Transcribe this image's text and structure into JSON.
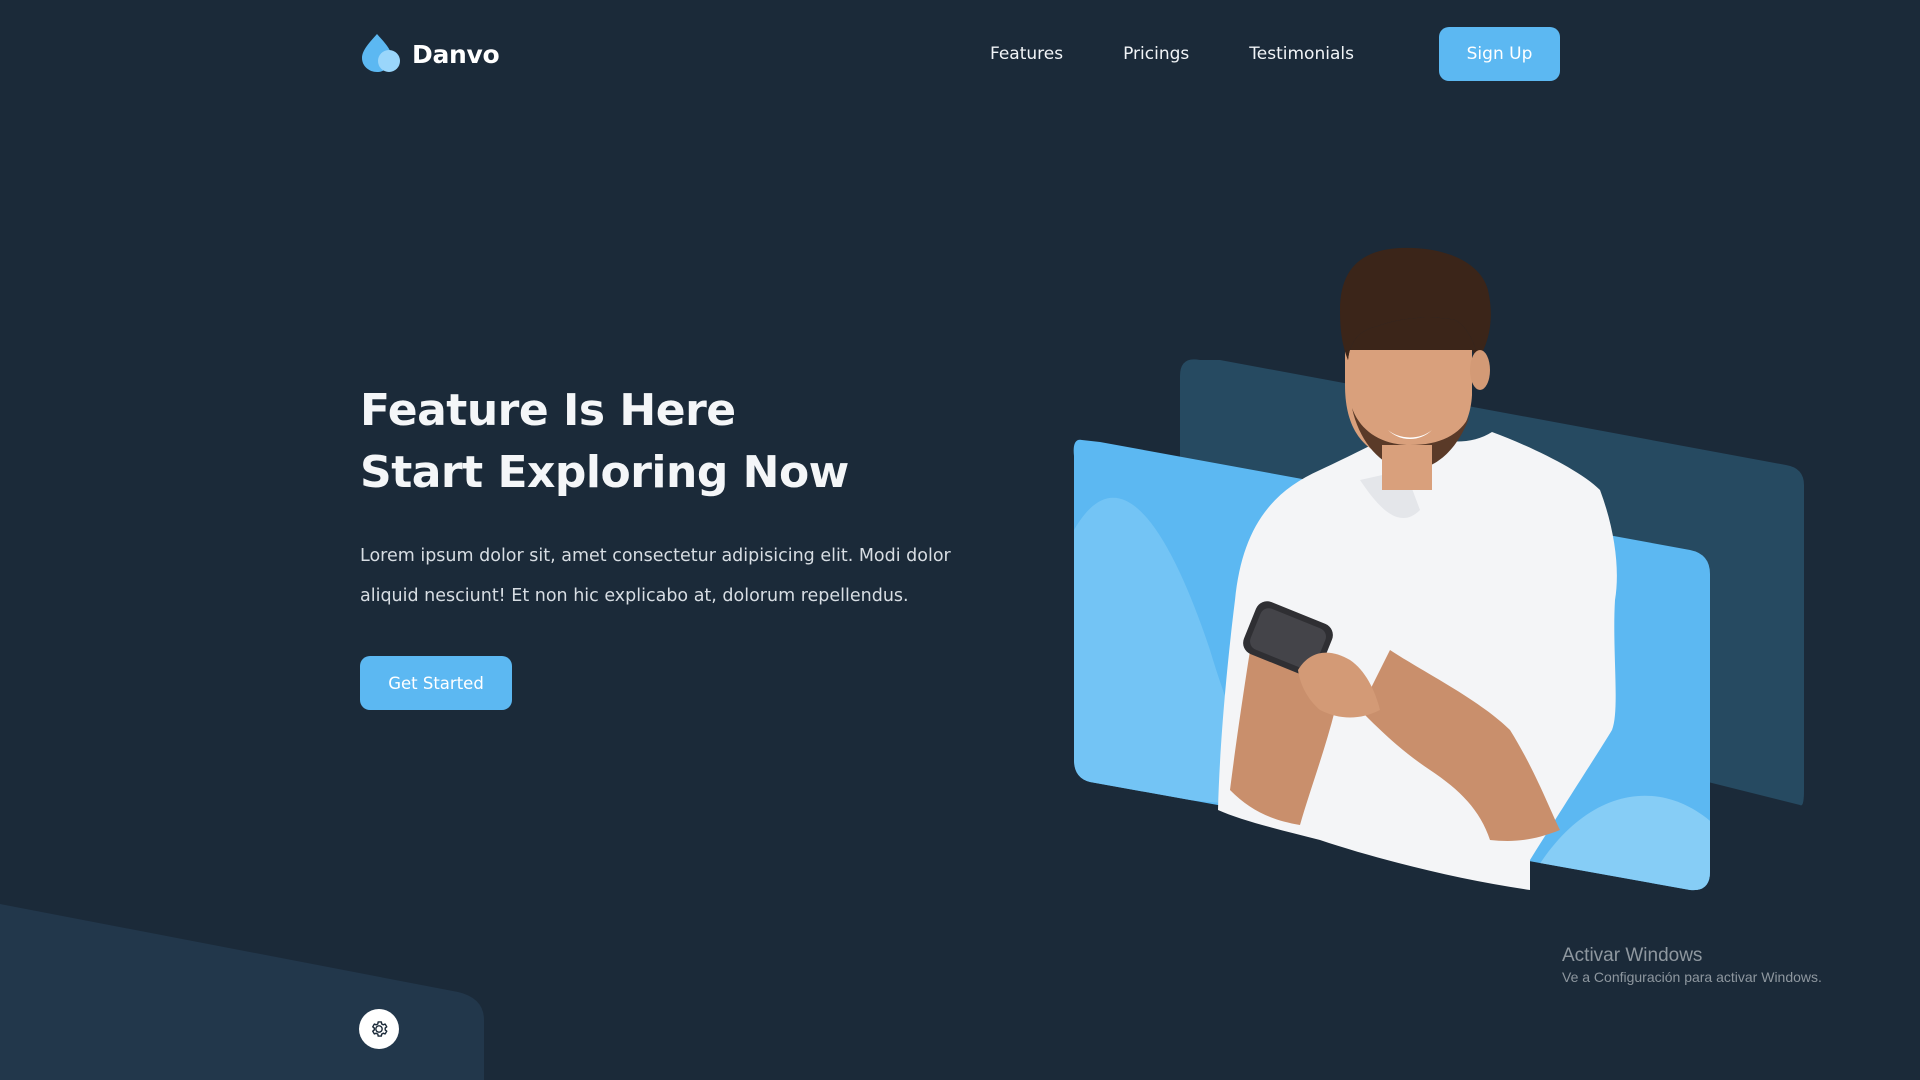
{
  "brand": {
    "name": "Danvo",
    "logo_icon": "water-drop-icon"
  },
  "nav": {
    "links": [
      {
        "label": "Features"
      },
      {
        "label": "Pricings"
      },
      {
        "label": "Testimonials"
      }
    ],
    "signup_label": "Sign Up"
  },
  "hero": {
    "title_line1": "Feature Is Here",
    "title_line2": "Start Exploring Now",
    "description": "Lorem ipsum dolor sit, amet consectetur adipisicing elit. Modi dolor aliquid nesciunt! Et non hic explicabo at, dolorum repellendus.",
    "cta_label": "Get Started",
    "image": "man-smiling-at-phone-photo"
  },
  "settings": {
    "icon": "gear-icon"
  },
  "watermark": {
    "title": "Activar Windows",
    "subtitle": "Ve a Configuración para activar Windows."
  },
  "colors": {
    "background": "#1b2a39",
    "accent": "#5cb8f2",
    "panel_dark": "#264a61",
    "corner_shape": "#22374b"
  }
}
